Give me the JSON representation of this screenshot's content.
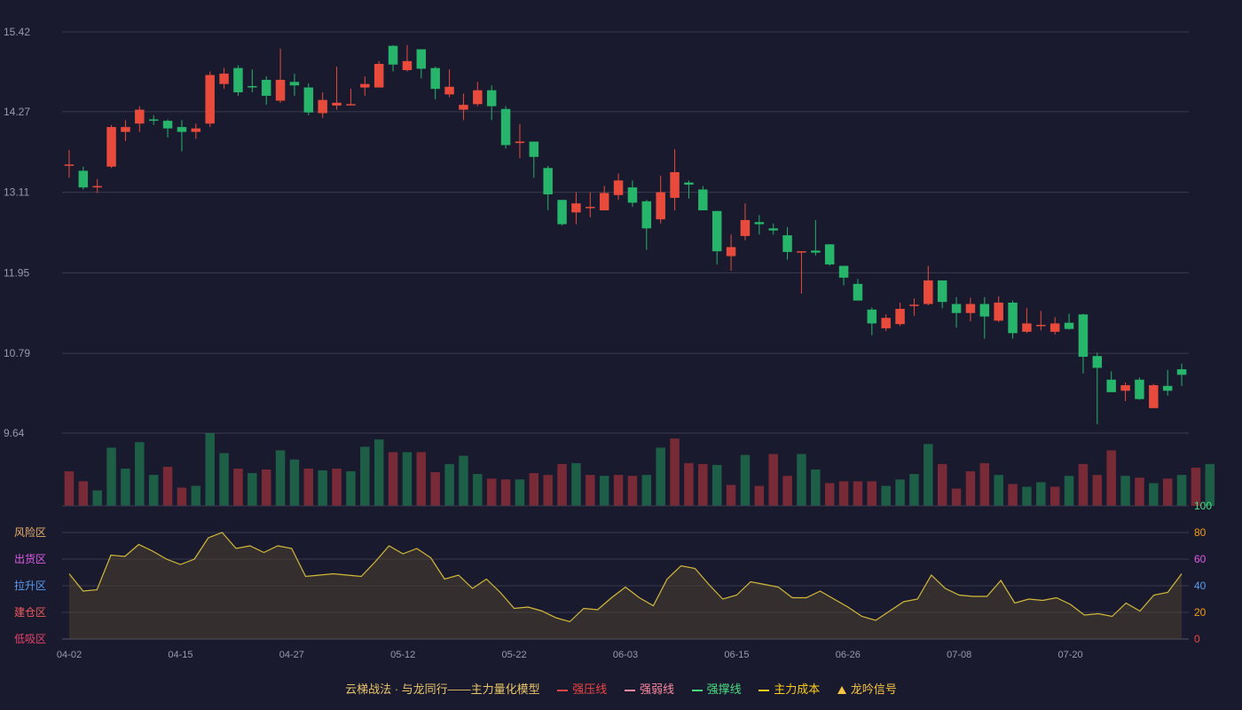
{
  "chart_data": {
    "type": "candlestick",
    "price_ticks": [
      "15.42",
      "14.27",
      "13.11",
      "11.95",
      "10.79",
      "9.64"
    ],
    "ylim": [
      9.64,
      15.42
    ],
    "x_ticks": [
      {
        "index": 0,
        "label": "04-02"
      },
      {
        "index": 8,
        "label": "04-15"
      },
      {
        "index": 16,
        "label": "04-27"
      },
      {
        "index": 24,
        "label": "05-12"
      },
      {
        "index": 32,
        "label": "05-22"
      },
      {
        "index": 40,
        "label": "06-03"
      },
      {
        "index": 48,
        "label": "06-15"
      },
      {
        "index": 56,
        "label": "06-26"
      },
      {
        "index": 64,
        "label": "07-08"
      },
      {
        "index": 72,
        "label": "07-20"
      }
    ],
    "ohlc": [
      [
        13.51,
        13.51,
        13.72,
        13.32
      ],
      [
        13.42,
        13.18,
        13.48,
        13.15
      ],
      [
        13.18,
        13.2,
        13.3,
        13.1
      ],
      [
        13.48,
        14.05,
        14.08,
        13.46
      ],
      [
        13.98,
        14.05,
        14.15,
        13.85
      ],
      [
        14.1,
        14.3,
        14.35,
        13.98
      ],
      [
        14.16,
        14.14,
        14.22,
        14.08
      ],
      [
        14.14,
        14.03,
        14.16,
        13.9
      ],
      [
        14.05,
        13.98,
        14.15,
        13.7
      ],
      [
        13.98,
        14.03,
        14.1,
        13.88
      ],
      [
        14.1,
        14.8,
        14.85,
        14.05
      ],
      [
        14.67,
        14.82,
        14.9,
        14.6
      ],
      [
        14.9,
        14.55,
        14.94,
        14.5
      ],
      [
        14.64,
        14.63,
        14.88,
        14.55
      ],
      [
        14.73,
        14.5,
        14.78,
        14.37
      ],
      [
        14.43,
        14.73,
        15.18,
        14.4
      ],
      [
        14.7,
        14.65,
        14.82,
        14.5
      ],
      [
        14.62,
        14.26,
        14.68,
        14.22
      ],
      [
        14.25,
        14.44,
        14.55,
        14.18
      ],
      [
        14.36,
        14.4,
        14.92,
        14.3
      ],
      [
        14.38,
        14.38,
        14.6,
        14.38
      ],
      [
        14.62,
        14.67,
        14.78,
        14.5
      ],
      [
        14.62,
        14.96,
        15.0,
        14.62
      ],
      [
        15.22,
        14.95,
        15.23,
        14.85
      ],
      [
        14.87,
        15.0,
        15.23,
        14.85
      ],
      [
        15.17,
        14.89,
        15.17,
        14.75
      ],
      [
        14.9,
        14.6,
        14.92,
        14.45
      ],
      [
        14.52,
        14.63,
        14.88,
        14.48
      ],
      [
        14.3,
        14.37,
        14.53,
        14.15
      ],
      [
        14.38,
        14.58,
        14.7,
        14.35
      ],
      [
        14.58,
        14.35,
        14.65,
        14.15
      ],
      [
        14.31,
        13.79,
        14.35,
        13.74
      ],
      [
        13.82,
        13.84,
        14.09,
        13.6
      ],
      [
        13.84,
        13.62,
        13.84,
        13.32
      ],
      [
        13.46,
        13.08,
        13.49,
        12.85
      ],
      [
        13.0,
        12.65,
        13.0,
        12.63
      ],
      [
        12.82,
        12.95,
        13.11,
        12.65
      ],
      [
        12.9,
        12.9,
        13.11,
        12.75
      ],
      [
        12.85,
        13.1,
        13.2,
        12.85
      ],
      [
        13.07,
        13.28,
        13.38,
        13.0
      ],
      [
        13.18,
        12.96,
        13.28,
        12.9
      ],
      [
        12.98,
        12.59,
        13.0,
        12.28
      ],
      [
        12.72,
        13.11,
        13.35,
        12.66
      ],
      [
        13.03,
        13.4,
        13.73,
        12.85
      ],
      [
        13.25,
        13.22,
        13.28,
        13.02
      ],
      [
        13.15,
        12.85,
        13.2,
        12.85
      ],
      [
        12.84,
        12.26,
        12.84,
        12.07
      ],
      [
        12.19,
        12.32,
        12.5,
        11.98
      ],
      [
        12.48,
        12.71,
        12.95,
        12.42
      ],
      [
        12.68,
        12.65,
        12.78,
        12.5
      ],
      [
        12.59,
        12.56,
        12.66,
        12.5
      ],
      [
        12.49,
        12.25,
        12.61,
        12.14
      ],
      [
        12.26,
        12.26,
        12.26,
        11.65
      ],
      [
        12.27,
        12.24,
        12.71,
        12.2
      ],
      [
        12.36,
        12.07,
        12.36,
        12.05
      ],
      [
        12.05,
        11.88,
        12.05,
        11.77
      ],
      [
        11.79,
        11.55,
        11.86,
        11.55
      ],
      [
        11.42,
        11.22,
        11.45,
        11.05
      ],
      [
        11.15,
        11.3,
        11.35,
        11.11
      ],
      [
        11.21,
        11.43,
        11.52,
        11.18
      ],
      [
        11.49,
        11.49,
        11.58,
        11.33
      ],
      [
        11.5,
        11.84,
        12.05,
        11.48
      ],
      [
        11.84,
        11.53,
        11.84,
        11.44
      ],
      [
        11.5,
        11.37,
        11.6,
        11.16
      ],
      [
        11.37,
        11.5,
        11.59,
        11.25
      ],
      [
        11.5,
        11.32,
        11.6,
        11.0
      ],
      [
        11.26,
        11.52,
        11.61,
        11.24
      ],
      [
        11.52,
        11.08,
        11.55,
        11.0
      ],
      [
        11.1,
        11.22,
        11.44,
        11.08
      ],
      [
        11.2,
        11.2,
        11.4,
        11.12
      ],
      [
        11.1,
        11.22,
        11.31,
        11.06
      ],
      [
        11.23,
        11.14,
        11.36,
        11.13
      ],
      [
        11.35,
        10.74,
        11.36,
        10.5
      ],
      [
        10.75,
        10.58,
        10.8,
        9.77
      ],
      [
        10.41,
        10.23,
        10.53,
        10.23
      ],
      [
        10.25,
        10.33,
        10.37,
        10.1
      ],
      [
        10.41,
        10.13,
        10.44,
        10.12
      ],
      [
        10.0,
        10.33,
        10.35,
        10.0
      ],
      [
        10.32,
        10.25,
        10.55,
        10.18
      ],
      [
        10.56,
        10.48,
        10.64,
        10.32
      ]
    ],
    "volume": [
      38,
      27,
      17,
      64,
      41,
      70,
      34,
      43,
      20,
      22,
      80,
      58,
      41,
      36,
      40,
      61,
      51,
      41,
      39,
      41,
      38,
      65,
      73,
      59,
      59,
      59,
      37,
      46,
      55,
      35,
      30,
      29,
      29,
      36,
      34,
      46,
      47,
      34,
      33,
      34,
      33,
      34,
      64,
      74,
      47,
      46,
      45,
      23,
      56,
      22,
      57,
      33,
      57,
      40,
      25,
      27,
      27,
      27,
      22,
      29,
      35,
      68,
      46,
      19,
      38,
      47,
      34,
      24,
      21,
      26,
      21,
      33,
      46,
      34,
      61,
      33,
      31,
      25,
      30,
      34,
      42,
      46
    ],
    "volume_colors": [
      "#8b2e38",
      "#8b2e38",
      "#1f6b4b",
      "#1f6b4b",
      "#1f6b4b",
      "#1f6b4b",
      "#1f6b4b",
      "#8b2e38",
      "#8b2e38",
      "#1f6b4b",
      "#1f6b4b",
      "#1f6b4b",
      "#8b2e38",
      "#1f6b4b",
      "#8b2e38",
      "#1f6b4b",
      "#1f6b4b",
      "#8b2e38",
      "#1f6b4b",
      "#8b2e38",
      "#1f6b4b",
      "#1f6b4b",
      "#1f6b4b",
      "#8b2e38",
      "#1f6b4b",
      "#8b2e38",
      "#8b2e38",
      "#1f6b4b",
      "#1f6b4b",
      "#1f6b4b",
      "#8b2e38",
      "#8b2e38",
      "#1f6b4b",
      "#8b2e38",
      "#8b2e38",
      "#8b2e38",
      "#1f6b4b",
      "#8b2e38",
      "#1f6b4b",
      "#8b2e38",
      "#8b2e38",
      "#1f6b4b",
      "#1f6b4b",
      "#8b2e38",
      "#8b2e38",
      "#8b2e38",
      "#1f6b4b",
      "#8b2e38",
      "#1f6b4b",
      "#8b2e38",
      "#8b2e38",
      "#8b2e38",
      "#1f6b4b",
      "#1f6b4b",
      "#8b2e38",
      "#8b2e38",
      "#8b2e38",
      "#8b2e38",
      "#1f6b4b",
      "#1f6b4b",
      "#1f6b4b",
      "#1f6b4b",
      "#8b2e38",
      "#8b2e38",
      "#8b2e38",
      "#8b2e38",
      "#1f6b4b",
      "#8b2e38",
      "#1f6b4b",
      "#1f6b4b",
      "#8b2e38",
      "#1f6b4b",
      "#8b2e38",
      "#8b2e38",
      "#8b2e38",
      "#1f6b4b",
      "#8b2e38",
      "#1f6b4b",
      "#8b2e38",
      "#1f6b4b",
      "#8b2e38",
      "#1f6b4b"
    ],
    "oscillator": {
      "values": [
        49,
        36,
        37,
        63,
        62,
        71,
        66,
        60,
        56,
        60,
        76,
        80,
        68,
        70,
        65,
        70,
        68,
        47,
        48,
        49,
        48,
        47,
        58,
        70,
        64,
        68,
        61,
        45,
        48,
        38,
        45,
        35,
        23,
        24,
        21,
        16,
        13,
        23,
        22,
        31,
        39,
        31,
        25,
        45,
        55,
        53,
        41,
        30,
        33,
        43,
        41,
        39,
        31,
        31,
        36,
        30,
        24,
        17,
        14,
        21,
        28,
        30,
        48,
        38,
        33,
        32,
        32,
        44,
        27,
        30,
        29,
        31,
        26,
        18,
        19,
        17,
        27,
        21,
        33,
        35,
        49
      ],
      "ticks": [
        "100",
        "80",
        "60",
        "40",
        "20",
        "0"
      ],
      "zone_labels": [
        {
          "label": "风险区",
          "color": "#e8b06a"
        },
        {
          "label": "出货区",
          "color": "#e05ce8"
        },
        {
          "label": "拉升区",
          "color": "#5a9cf0"
        },
        {
          "label": "建仓区",
          "color": "#ef5b5b"
        },
        {
          "label": "低吸区",
          "color": "#e8426b"
        }
      ]
    },
    "legend": {
      "title": "云梯战法 · 与龙同行——主力量化模型",
      "items": [
        {
          "label": "强压线",
          "color": "#ef4444",
          "style": "solid"
        },
        {
          "label": "强弱线",
          "color": "#fb8aa0",
          "style": "dash"
        },
        {
          "label": "强撑线",
          "color": "#4ade80",
          "style": "solid"
        },
        {
          "label": "主力成本",
          "color": "#facc15",
          "style": "dash"
        },
        {
          "label": "龙吟信号",
          "color": "#f5c542",
          "style": "triangle"
        }
      ]
    },
    "colors": {
      "background": "#1a1a2e",
      "up": "#e84b3c",
      "down": "#26b56a",
      "grid": "#3a3a4e",
      "axis_text": "#9a9aaa",
      "oscillator_line": "#d4b93a",
      "tick_100": "#4ade80",
      "tick_80": "#f59e0b",
      "tick_60": "#e05ce8",
      "tick_40": "#5a9cf0",
      "tick_20": "#f59e0b",
      "tick_0": "#ef4444"
    }
  }
}
